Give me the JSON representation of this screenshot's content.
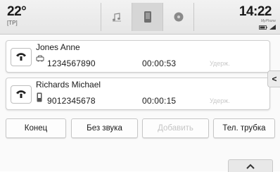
{
  "status_bar": {
    "temperature": "22°",
    "traffic_program": "[TP]",
    "time": "14:22",
    "brand": "MyPhone",
    "tabs": [
      {
        "icon": "music-note-icon"
      },
      {
        "icon": "phone-handset-icon"
      },
      {
        "icon": "navigation-globe-icon"
      }
    ],
    "active_tab_index": 1
  },
  "calls": [
    {
      "name": "Jones Anne",
      "number": "1234567890",
      "duration": "00:00:53",
      "status": "Удерж.",
      "device_icon": "car-icon"
    },
    {
      "name": "Richards Michael",
      "number": "9012345678",
      "duration": "00:00:15",
      "status": "Удерж.",
      "device_icon": "mobile-phone-icon"
    }
  ],
  "side_tab_label": "<",
  "actions": {
    "end_label": "Конец",
    "mute_label": "Без звука",
    "add_label": "Добавить",
    "handset_label": "Тел. трубка"
  },
  "colors": {
    "disabled_text": "#c5c5c5",
    "active_tab": "#d6d6d6"
  }
}
